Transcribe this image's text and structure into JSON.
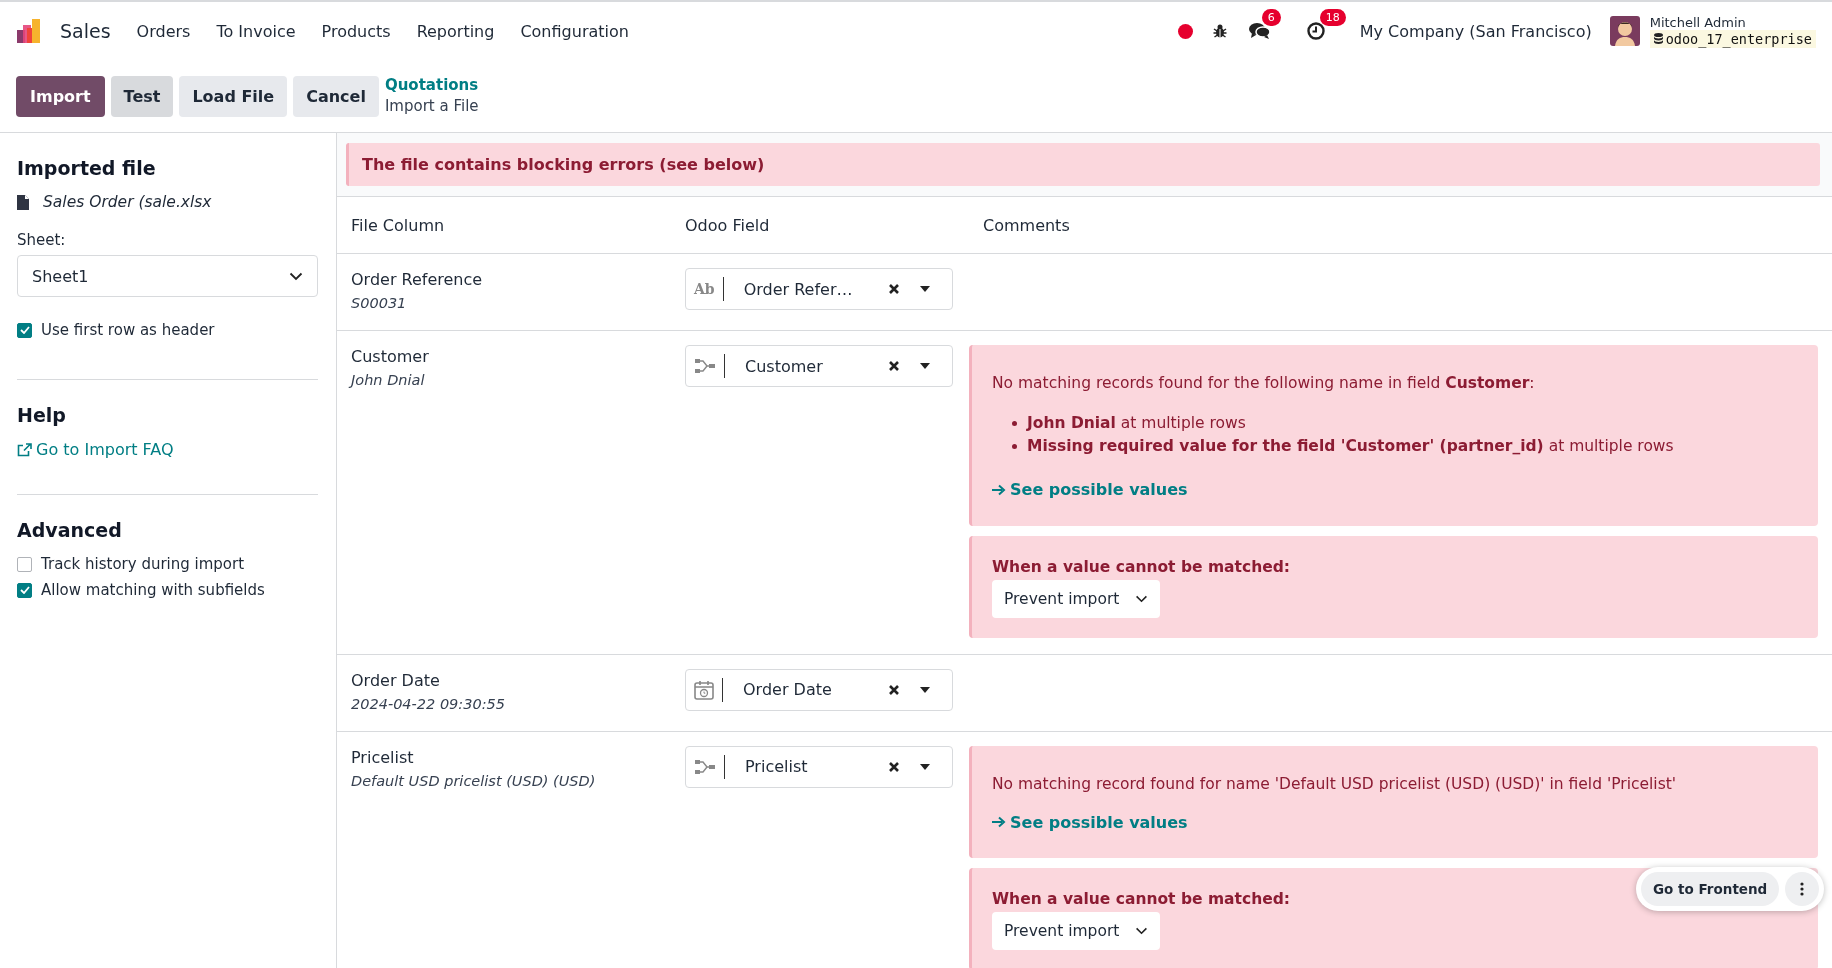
{
  "navbar": {
    "app": "Sales",
    "menu": [
      "Orders",
      "To Invoice",
      "Products",
      "Reporting",
      "Configuration"
    ],
    "systray": {
      "chat_count": "6",
      "activity_count": "18"
    },
    "company": "My Company (San Francisco)",
    "user": {
      "name": "Mitchell Admin",
      "database": "odoo_17_enterprise"
    }
  },
  "control_panel": {
    "buttons": [
      {
        "label": "Import",
        "kind": "primary"
      },
      {
        "label": "Test",
        "kind": "hovered"
      },
      {
        "label": "Load File",
        "kind": "secondary"
      },
      {
        "label": "Cancel",
        "kind": "secondary"
      }
    ],
    "breadcrumb": {
      "parent": "Quotations",
      "current": "Import a File"
    }
  },
  "sidebar": {
    "imported_title": "Imported file",
    "file_name": "Sales Order (sale.xlsx",
    "sheet_label": "Sheet:",
    "sheet_value": "Sheet1",
    "header_option": {
      "label": "Use first row as header",
      "checked": true
    },
    "help_title": "Help",
    "help_link": "Go to Import FAQ",
    "advanced_title": "Advanced",
    "advanced_options": [
      {
        "label": "Track history during import",
        "checked": false
      },
      {
        "label": "Allow matching with subfields",
        "checked": true
      }
    ]
  },
  "alert": "The file contains blocking errors (see below)",
  "table": {
    "columns": [
      "File Column",
      "Odoo Field",
      "Comments"
    ],
    "rows": [
      {
        "column": "Order Reference",
        "sample": "S00031",
        "field": "Order Refer…",
        "kind": "char",
        "type_glyph": "Ab",
        "comments": []
      },
      {
        "column": "Customer",
        "sample": "John Dnial",
        "field": "Customer",
        "kind": "relation",
        "comments": [
          {
            "kind": "error",
            "message": "No matching records found for the following name in field **Customer**:",
            "bullets": [
              "**John Dnial** at multiple rows",
              "**Missing required value for the field 'Customer' (partner_id)** at multiple rows"
            ],
            "link": "See possible values"
          },
          {
            "kind": "fallback",
            "label": "When a value cannot be matched:",
            "value": "Prevent import"
          }
        ]
      },
      {
        "column": "Order Date",
        "sample": "2024-04-22 09:30:55",
        "field": "Order Date",
        "kind": "date",
        "comments": []
      },
      {
        "column": "Pricelist",
        "sample": "Default USD pricelist (USD) (USD)",
        "field": "Pricelist",
        "kind": "relation",
        "comments": [
          {
            "kind": "error",
            "message": "No matching record found for name 'Default USD pricelist (USD) (USD)' in field 'Pricelist'",
            "link": "See possible values"
          },
          {
            "kind": "fallback",
            "label": "When a value cannot be matched:",
            "value": "Prevent import"
          }
        ]
      }
    ]
  },
  "floating": {
    "button": "Go to Frontend"
  }
}
